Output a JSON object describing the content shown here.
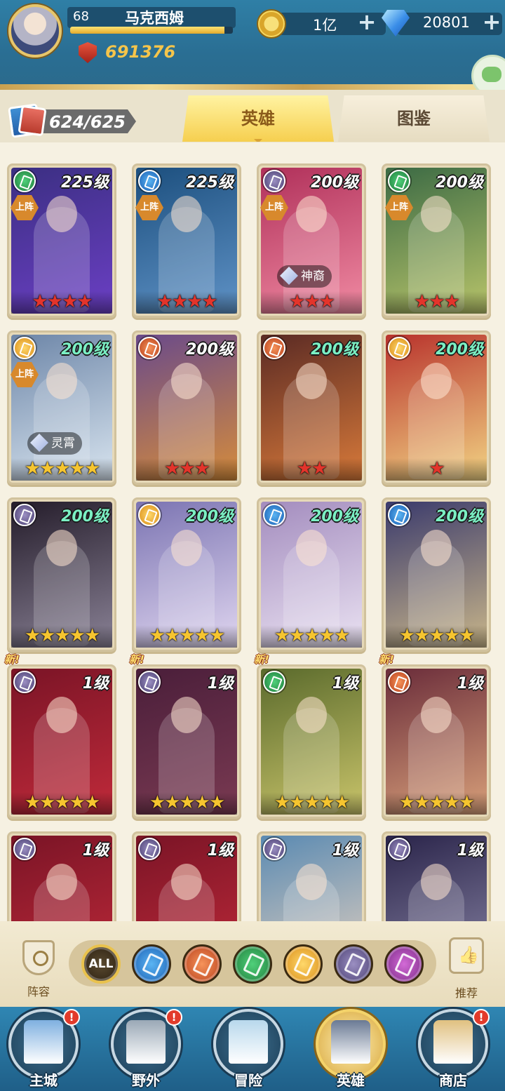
{
  "player": {
    "level": "68",
    "name": "马克西姆",
    "xp_fraction": 0.95,
    "power": "691376"
  },
  "currency": {
    "gold": "1亿",
    "gems": "20801"
  },
  "collection": {
    "count": "624/625"
  },
  "tabs": {
    "heroes": "英雄",
    "codex": "图鉴"
  },
  "heroes": [
    {
      "level": "225级",
      "faction": "storm",
      "deployed": true,
      "stars": 4,
      "star_color": "red",
      "level_color": "white",
      "art": [
        "#3b2f82",
        "#6b3fc4"
      ]
    },
    {
      "level": "225级",
      "faction": "water",
      "deployed": true,
      "stars": 4,
      "star_color": "red",
      "level_color": "white",
      "art": [
        "#1c4f7e",
        "#5f92c6"
      ]
    },
    {
      "level": "200级",
      "faction": "dark",
      "deployed": true,
      "stars": 3,
      "star_color": "red",
      "level_color": "white",
      "awaken": "神裔",
      "art": [
        "#b0305a",
        "#f08aa2"
      ]
    },
    {
      "level": "200级",
      "faction": "storm",
      "deployed": true,
      "stars": 3,
      "star_color": "red",
      "level_color": "white",
      "art": [
        "#3b6a44",
        "#b8c46a"
      ]
    },
    {
      "level": "200级",
      "faction": "light",
      "deployed": true,
      "stars": 5,
      "star_color": "gold",
      "level_color": "green",
      "awaken": "灵霄",
      "art": [
        "#6d86a8",
        "#d8e4ef"
      ]
    },
    {
      "level": "200级",
      "faction": "fire",
      "deployed": false,
      "stars": 3,
      "star_color": "red",
      "level_color": "white",
      "art": [
        "#6a4a8a",
        "#d58c3c"
      ]
    },
    {
      "level": "200级",
      "faction": "fire",
      "deployed": false,
      "stars": 2,
      "star_color": "red",
      "level_color": "green",
      "art": [
        "#5a2a24",
        "#d87a3a"
      ]
    },
    {
      "level": "200级",
      "faction": "light",
      "deployed": false,
      "stars": 1,
      "star_color": "red",
      "level_color": "green",
      "art": [
        "#b8322c",
        "#f2d484"
      ]
    },
    {
      "level": "200级",
      "faction": "dark",
      "deployed": false,
      "stars": 5,
      "star_color": "gold",
      "level_color": "green",
      "art": [
        "#241c2a",
        "#8a8296"
      ]
    },
    {
      "level": "200级",
      "faction": "light",
      "deployed": false,
      "stars": 5,
      "star_color": "gold",
      "level_color": "green",
      "art": [
        "#7b74b2",
        "#e0d6f0"
      ]
    },
    {
      "level": "200级",
      "faction": "water",
      "deployed": false,
      "stars": 5,
      "star_color": "gold",
      "level_color": "green",
      "art": [
        "#a38cbe",
        "#eae2f2"
      ]
    },
    {
      "level": "200级",
      "faction": "water",
      "deployed": false,
      "stars": 5,
      "star_color": "gold",
      "level_color": "green",
      "art": [
        "#3a3a6c",
        "#c9b68a"
      ]
    },
    {
      "level": "1级",
      "faction": "dark",
      "deployed": false,
      "stars": 5,
      "star_color": "gold",
      "level_color": "white",
      "new": "新!",
      "art": [
        "#7a1426",
        "#c02a3a"
      ]
    },
    {
      "level": "1级",
      "faction": "dark",
      "deployed": false,
      "stars": 5,
      "star_color": "gold",
      "level_color": "white",
      "new": "新!",
      "art": [
        "#4a1e3a",
        "#7a3a52"
      ]
    },
    {
      "level": "1级",
      "faction": "storm",
      "deployed": false,
      "stars": 5,
      "star_color": "gold",
      "level_color": "white",
      "new": "新!",
      "art": [
        "#5a6a2c",
        "#c9c46a"
      ]
    },
    {
      "level": "1级",
      "faction": "fire",
      "deployed": false,
      "stars": 5,
      "star_color": "gold",
      "level_color": "white",
      "new": "新!",
      "art": [
        "#6a2c3a",
        "#d8a07a"
      ]
    },
    {
      "level": "1级",
      "faction": "dark",
      "deployed": false,
      "stars": 0,
      "star_color": "gold",
      "level_color": "white",
      "art": [
        "#7a1426",
        "#c02a3a"
      ]
    },
    {
      "level": "1级",
      "faction": "dark",
      "deployed": false,
      "stars": 0,
      "star_color": "gold",
      "level_color": "white",
      "art": [
        "#7a1426",
        "#c02a3a"
      ]
    },
    {
      "level": "1级",
      "faction": "dark",
      "deployed": false,
      "stars": 0,
      "star_color": "gold",
      "level_color": "white",
      "art": [
        "#5a8ab2",
        "#e6d2c0"
      ]
    },
    {
      "level": "1级",
      "faction": "dark",
      "deployed": false,
      "stars": 0,
      "star_color": "gold",
      "level_color": "white",
      "art": [
        "#2a244a",
        "#8a86a6"
      ]
    }
  ],
  "deploy_label": "上阵",
  "filters": {
    "lineup_label": "阵容",
    "recommend_label": "推荐",
    "all_label": "ALL",
    "selected": "ALL",
    "factions": [
      "water",
      "fire",
      "storm",
      "light",
      "dark",
      "arcane"
    ]
  },
  "nav": [
    {
      "label": "主城",
      "notify": true,
      "art": "#7fb0e0"
    },
    {
      "label": "野外",
      "notify": true,
      "art": "#9aa8b6"
    },
    {
      "label": "冒险",
      "notify": false,
      "art": "#b8d8ec"
    },
    {
      "label": "英雄",
      "notify": false,
      "active": true,
      "art": "#6a7a94"
    },
    {
      "label": "商店",
      "notify": true,
      "art": "#e0c080"
    }
  ],
  "notify_mark": "!"
}
